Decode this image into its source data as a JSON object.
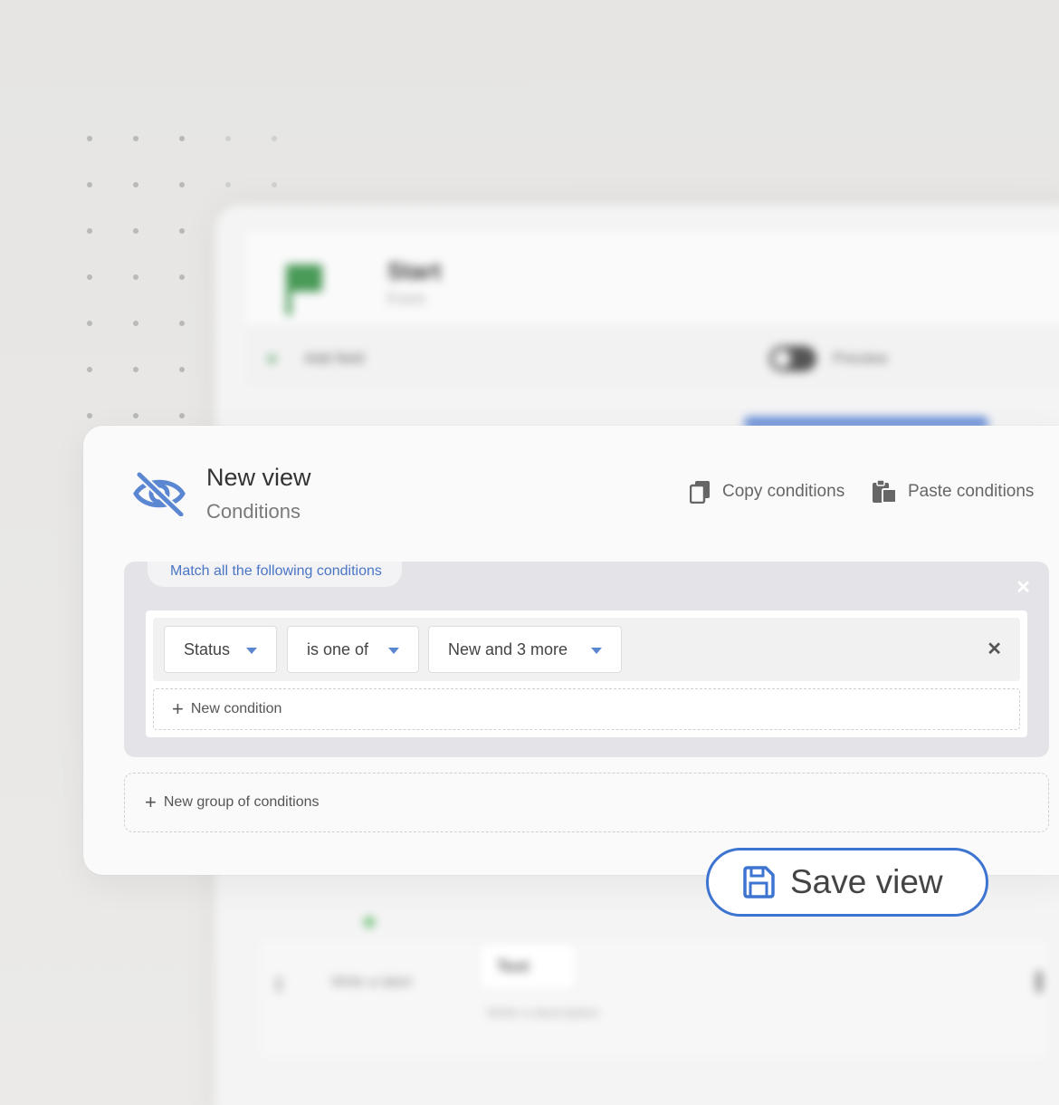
{
  "background_app": {
    "title": "Start",
    "subtitle": "Form",
    "add_field_label": "Add field",
    "preview_label": "Preview",
    "field_label": "Write a label",
    "field_type": "Text",
    "field_description": "Write a description"
  },
  "modal": {
    "title": "New view",
    "subtitle": "Conditions",
    "copy_label": "Copy conditions",
    "paste_label": "Paste conditions"
  },
  "group": {
    "match_label": "Match all the following conditions",
    "condition": {
      "field": "Status",
      "operator": "is one of",
      "value": "New and 3 more"
    },
    "new_condition_label": "New condition"
  },
  "new_group_label": "New group of conditions",
  "save_label": "Save view",
  "colors": {
    "accent": "#3d74d1",
    "link": "#4a75c4",
    "group_bg": "#e3e3e8"
  },
  "icons": {
    "view": "eye-slash-icon",
    "copy": "copy-icon",
    "paste": "clipboard-icon",
    "save": "floppy-disk-icon"
  }
}
